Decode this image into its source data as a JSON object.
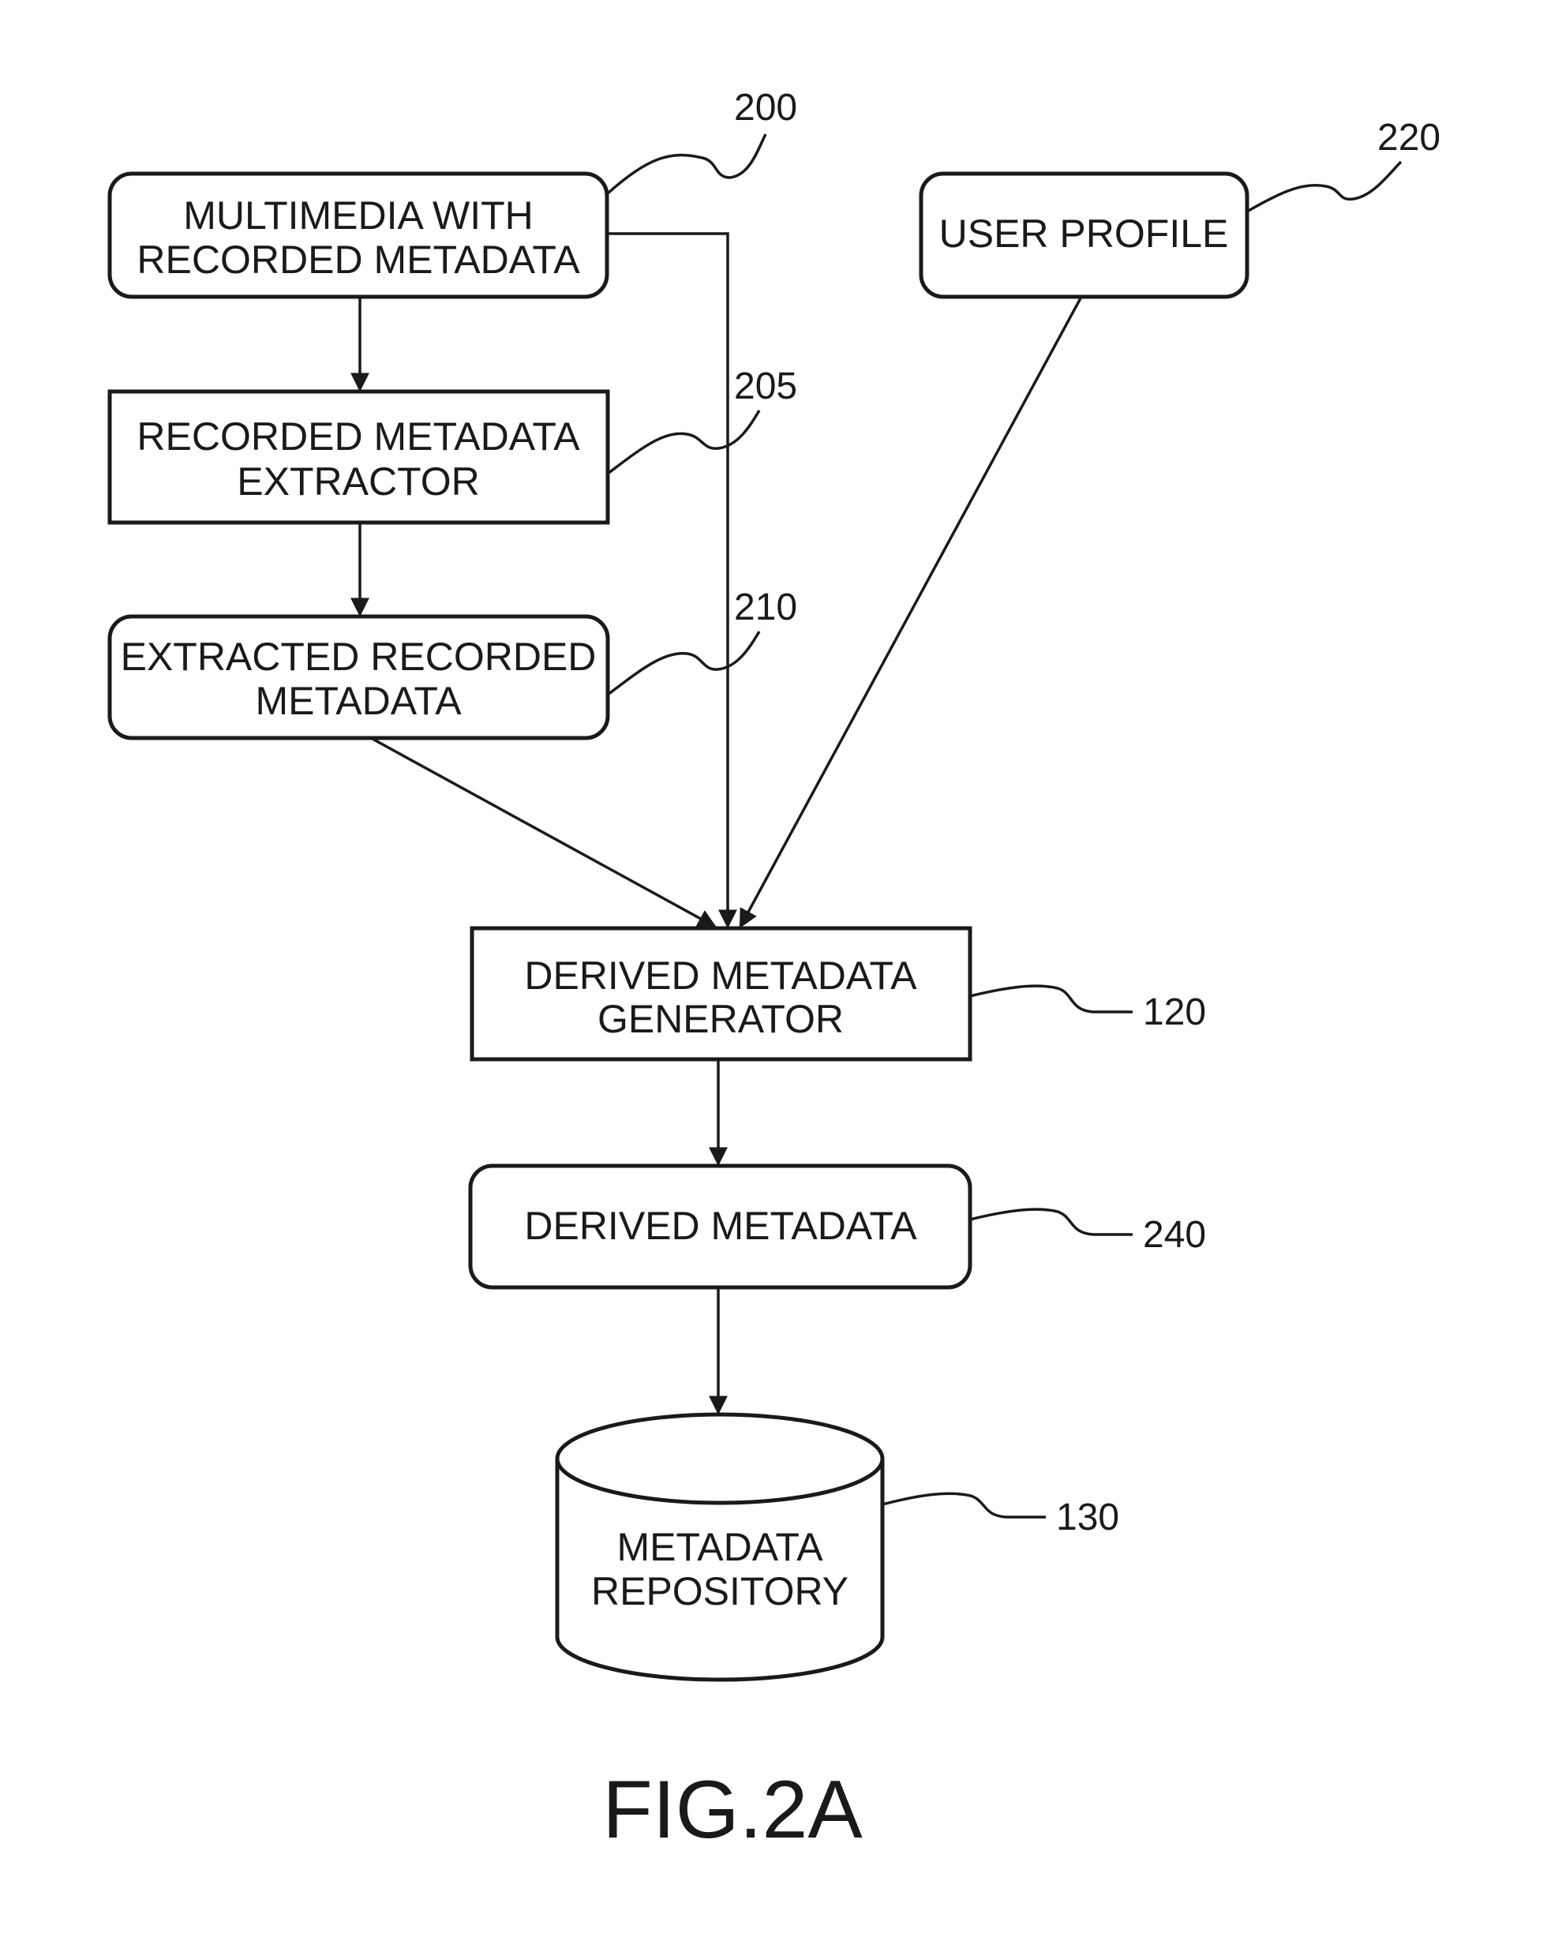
{
  "figure": {
    "caption": "FIG.2A",
    "nodes": [
      {
        "id": "200",
        "ref": "200",
        "shape": "rounded-rect",
        "lines": [
          "MULTIMEDIA WITH",
          "RECORDED METADATA"
        ]
      },
      {
        "id": "205",
        "ref": "205",
        "shape": "rect",
        "lines": [
          "RECORDED METADATA",
          "EXTRACTOR"
        ]
      },
      {
        "id": "210",
        "ref": "210",
        "shape": "rounded-rect",
        "lines": [
          "EXTRACTED RECORDED",
          "METADATA"
        ]
      },
      {
        "id": "220",
        "ref": "220",
        "shape": "rounded-rect",
        "lines": [
          "USER PROFILE"
        ]
      },
      {
        "id": "120",
        "ref": "120",
        "shape": "rect",
        "lines": [
          "DERIVED METADATA",
          "GENERATOR"
        ]
      },
      {
        "id": "240",
        "ref": "240",
        "shape": "rounded-rect",
        "lines": [
          "DERIVED METADATA"
        ]
      },
      {
        "id": "130",
        "ref": "130",
        "shape": "cylinder",
        "lines": [
          "METADATA",
          "REPOSITORY"
        ]
      }
    ],
    "edges": [
      {
        "from": "200",
        "to": "205"
      },
      {
        "from": "205",
        "to": "210"
      },
      {
        "from": "200",
        "to": "120"
      },
      {
        "from": "210",
        "to": "120"
      },
      {
        "from": "220",
        "to": "120"
      },
      {
        "from": "120",
        "to": "240"
      },
      {
        "from": "240",
        "to": "130"
      }
    ]
  }
}
